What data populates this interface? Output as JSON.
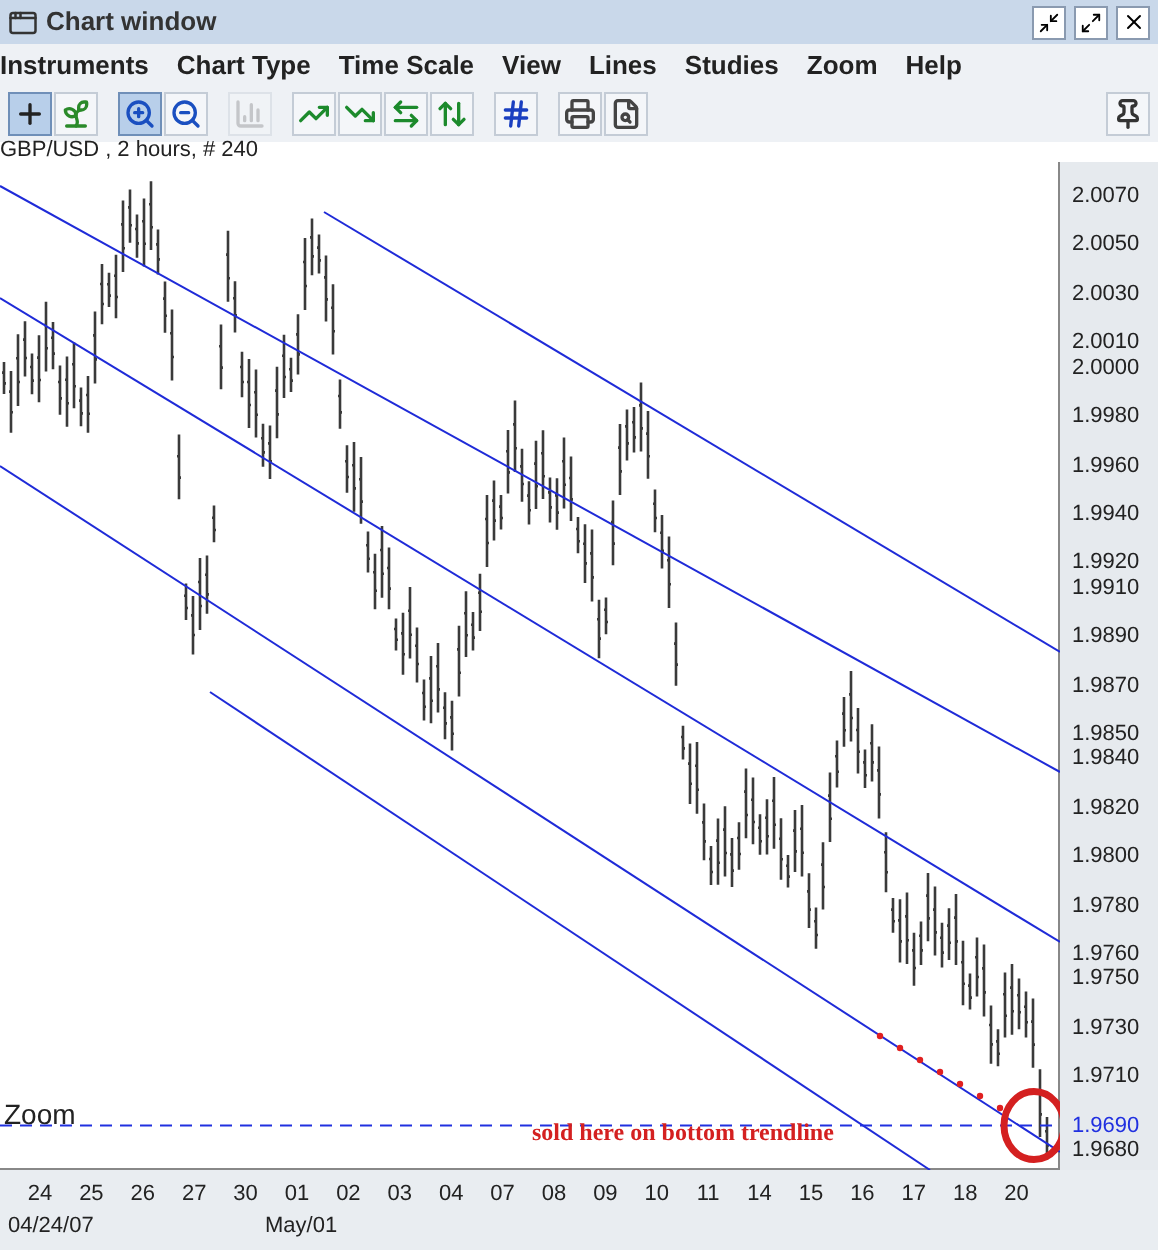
{
  "window": {
    "title": "Chart window"
  },
  "menu": [
    "Instruments",
    "Chart Type",
    "Time Scale",
    "View",
    "Lines",
    "Studies",
    "Zoom",
    "Help"
  ],
  "toolbar": {
    "groups": [
      {
        "buttons": [
          {
            "kind": "crosshair",
            "selected": true,
            "disabled": false
          },
          {
            "kind": "plant",
            "selected": false,
            "disabled": false
          }
        ]
      },
      {
        "buttons": [
          {
            "kind": "zoom-in",
            "selected": true,
            "disabled": false
          },
          {
            "kind": "zoom-out",
            "selected": false,
            "disabled": false
          }
        ]
      },
      {
        "buttons": [
          {
            "kind": "bars",
            "selected": false,
            "disabled": true
          }
        ]
      },
      {
        "buttons": [
          {
            "kind": "trend-up",
            "selected": false,
            "disabled": false
          },
          {
            "kind": "trend-down",
            "selected": false,
            "disabled": false
          },
          {
            "kind": "trend-left",
            "selected": false,
            "disabled": false
          },
          {
            "kind": "trend-vertical",
            "selected": false,
            "disabled": false
          }
        ]
      },
      {
        "buttons": [
          {
            "kind": "grid",
            "selected": false,
            "disabled": false
          }
        ]
      },
      {
        "buttons": [
          {
            "kind": "print",
            "selected": false,
            "disabled": false
          },
          {
            "kind": "preview",
            "selected": false,
            "disabled": false
          }
        ]
      }
    ],
    "right_button": {
      "kind": "pin",
      "selected": false,
      "disabled": false
    }
  },
  "chart": {
    "title": "GBP/USD , 2 hours, # 240",
    "y_labels": [
      {
        "text": "2.0070",
        "kind": "tick"
      },
      {
        "text": "2.0050",
        "kind": "tick"
      },
      {
        "text": "2.0030",
        "kind": "tick"
      },
      {
        "text": "2.0010",
        "kind": "tick"
      },
      {
        "text": "2.0000",
        "kind": "tick"
      },
      {
        "text": "1.9980",
        "kind": "tick"
      },
      {
        "text": "1.9960",
        "kind": "tick"
      },
      {
        "text": "1.9940",
        "kind": "tick"
      },
      {
        "text": "1.9920",
        "kind": "tick"
      },
      {
        "text": "1.9910",
        "kind": "tick"
      },
      {
        "text": "1.9890",
        "kind": "tick"
      },
      {
        "text": "1.9870",
        "kind": "tick"
      },
      {
        "text": "1.9850",
        "kind": "tick"
      },
      {
        "text": "1.9840",
        "kind": "tick"
      },
      {
        "text": "1.9820",
        "kind": "tick"
      },
      {
        "text": "1.9800",
        "kind": "tick"
      },
      {
        "text": "1.9780",
        "kind": "tick"
      },
      {
        "text": "1.9760",
        "kind": "tick"
      },
      {
        "text": "1.9750",
        "kind": "tick"
      },
      {
        "text": "1.9730",
        "kind": "tick"
      },
      {
        "text": "1.9710",
        "kind": "tick"
      },
      {
        "text": "1.9690",
        "kind": "current"
      },
      {
        "text": "1.9680",
        "kind": "tick"
      }
    ],
    "x_labels": [
      {
        "text": "24",
        "sublabel": "04/24/07"
      },
      {
        "text": "25"
      },
      {
        "text": "26"
      },
      {
        "text": "27"
      },
      {
        "text": "30"
      },
      {
        "text": "01",
        "sublabel": "May/01"
      },
      {
        "text": "02"
      },
      {
        "text": "03"
      },
      {
        "text": "04"
      },
      {
        "text": "07"
      },
      {
        "text": "08"
      },
      {
        "text": "09"
      },
      {
        "text": "10"
      },
      {
        "text": "11"
      },
      {
        "text": "14"
      },
      {
        "text": "15"
      },
      {
        "text": "16"
      },
      {
        "text": "17"
      },
      {
        "text": "18"
      },
      {
        "text": "20"
      }
    ],
    "zoom_label": "Zoom",
    "annotation": "sold here on bottom trendline"
  }
}
